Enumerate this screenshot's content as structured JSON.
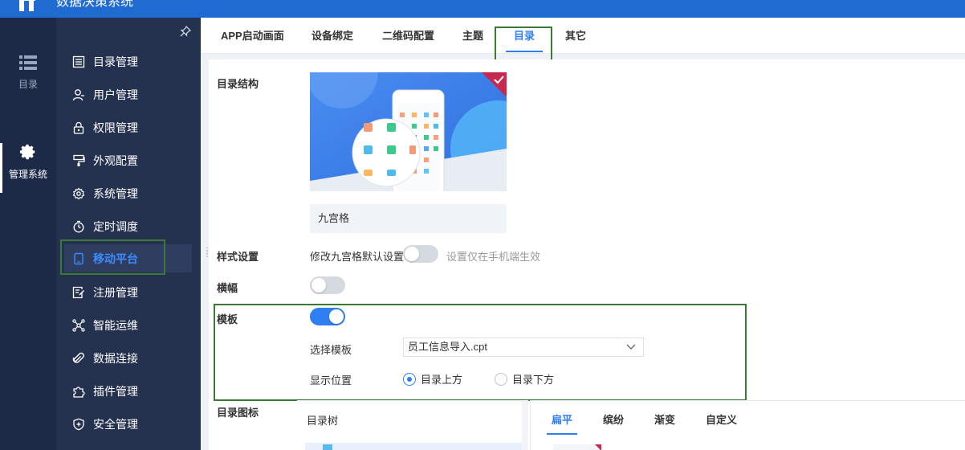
{
  "app": {
    "title": "数据决策系统"
  },
  "rail": {
    "items": [
      {
        "label": "目录",
        "icon": "list-icon"
      },
      {
        "label": "管理系统",
        "icon": "gear-icon",
        "active": true
      }
    ]
  },
  "sidebar": {
    "items": [
      {
        "label": "目录管理",
        "icon": "list-box-icon"
      },
      {
        "label": "用户管理",
        "icon": "user-icon"
      },
      {
        "label": "权限管理",
        "icon": "lock-icon"
      },
      {
        "label": "外观配置",
        "icon": "brush-icon"
      },
      {
        "label": "系统管理",
        "icon": "gear-icon"
      },
      {
        "label": "定时调度",
        "icon": "clock-icon"
      },
      {
        "label": "移动平台",
        "icon": "mobile-icon",
        "active": true
      },
      {
        "label": "注册管理",
        "icon": "register-icon"
      },
      {
        "label": "智能运维",
        "icon": "network-icon"
      },
      {
        "label": "数据连接",
        "icon": "link-icon"
      },
      {
        "label": "插件管理",
        "icon": "puzzle-icon"
      },
      {
        "label": "安全管理",
        "icon": "shield-icon"
      }
    ]
  },
  "tabs": [
    {
      "label": "APP启动画面"
    },
    {
      "label": "设备绑定"
    },
    {
      "label": "二维码配置"
    },
    {
      "label": "主题"
    },
    {
      "label": "目录",
      "active": true
    },
    {
      "label": "其它"
    }
  ],
  "catalog": {
    "structure_label": "目录结构",
    "preview_caption": "九宫格",
    "style_label": "样式设置",
    "style_toggle_label": "修改九宫格默认设置",
    "style_toggle_on": false,
    "style_hint": "设置仅在手机端生效",
    "banner_label": "横幅",
    "banner_on": false,
    "template_label": "模板",
    "template_on": true,
    "select_template_label": "选择模板",
    "selected_template": "员工信息导入.cpt",
    "position_label": "显示位置",
    "position_options": [
      {
        "label": "目录上方",
        "selected": true
      },
      {
        "label": "目录下方",
        "selected": false
      }
    ],
    "icon_label": "目录图标",
    "tree_header": "目录树",
    "style_tabs": [
      {
        "label": "扁平",
        "active": true
      },
      {
        "label": "缤纷"
      },
      {
        "label": "渐变"
      },
      {
        "label": "自定义"
      }
    ]
  },
  "colors": {
    "accent": "#2f7ff0",
    "topbar": "#1f6bd1",
    "sidebar": "#24314f",
    "highlight": "#3a7a34"
  }
}
